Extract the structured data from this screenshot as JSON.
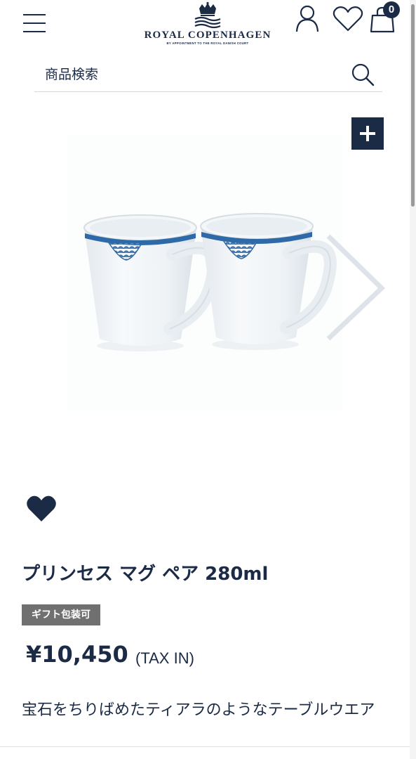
{
  "header": {
    "brand_name": "ROYAL COPENHAGEN",
    "brand_tagline": "BY APPOINTMENT TO THE ROYAL DANISH COURT",
    "cart_count": "0",
    "icons": [
      "menu-icon",
      "crown-logo",
      "account-icon",
      "heart-icon",
      "cart-bag-icon"
    ]
  },
  "search": {
    "placeholder": "商品検索",
    "icon": "search-icon"
  },
  "gallery": {
    "zoom_icon": "plus-icon",
    "next_icon": "chevron-right-icon",
    "image_subject": "mug pair"
  },
  "product": {
    "title": "プリンセス マグ ペア 280ml",
    "gift_badge": "ギフト包装可",
    "price": "¥10,450",
    "tax_label": "(TAX IN)",
    "description": "宝石をちりばめたティアラのようなテーブルウエア"
  },
  "colors": {
    "brand_navy": "#1b2a45",
    "badge_gray": "#707070",
    "pattern_blue": "#2f6aa8"
  }
}
